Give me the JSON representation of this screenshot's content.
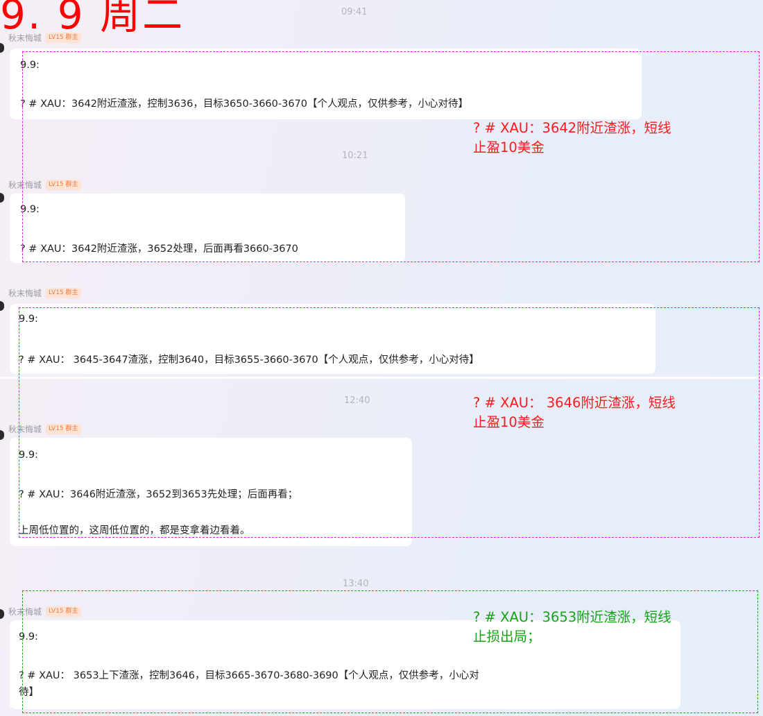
{
  "headline": "9. 9 周二",
  "messages": [
    {
      "time": "09:41",
      "sender": "秋末悔城",
      "badge": "LV15 群主",
      "lines": [
        "9.9:",
        "? # XAU：3642附近渣涨，控制3636，目标3650-3660-3670【个人观点，仅供参考，小心对待】"
      ]
    },
    {
      "time": "10:21",
      "sender": "秋末悔城",
      "badge": "LV15 群主",
      "lines": [
        "9.9:",
        "? # XAU：3642附近渣涨，3652处理，后面再看3660-3670"
      ]
    },
    {
      "sender": "秋末悔城",
      "badge": "LV15 群主",
      "lines": [
        "9.9:",
        "? # XAU： 3645-3647渣涨，控制3640，目标3655-3660-3670【个人观点，仅供参考，小心对待】"
      ]
    },
    {
      "time": "12:40",
      "sender": "秋末悔城",
      "badge": "LV15 群主",
      "lines": [
        "9.9:",
        "? # XAU：3646附近渣涨，3652到3653先处理；后面再看；",
        "上周低位置的，这周低位置的，都是变拿着边看着。"
      ]
    },
    {
      "time": "13:40",
      "sender": "秋末悔城",
      "badge": "LV15 群主",
      "lines": [
        "9.9:",
        "? # XAU： 3653上下渣涨，控制3646，目标3665-3670-3680-3690【个人观点，仅供参考，小心对",
        "待】"
      ]
    }
  ],
  "annotations": [
    {
      "color": "#ff1a1a",
      "lines": [
        "? # XAU：3642附近渣涨，短线",
        "止盈10美金"
      ]
    },
    {
      "color": "#ff1a1a",
      "lines": [
        "? # XAU： 3646附近渣涨，短线",
        "止盈10美金"
      ]
    },
    {
      "color": "#16a316",
      "lines": [
        "? # XAU：3653附近渣涨，短线",
        "止损出局；"
      ]
    }
  ]
}
